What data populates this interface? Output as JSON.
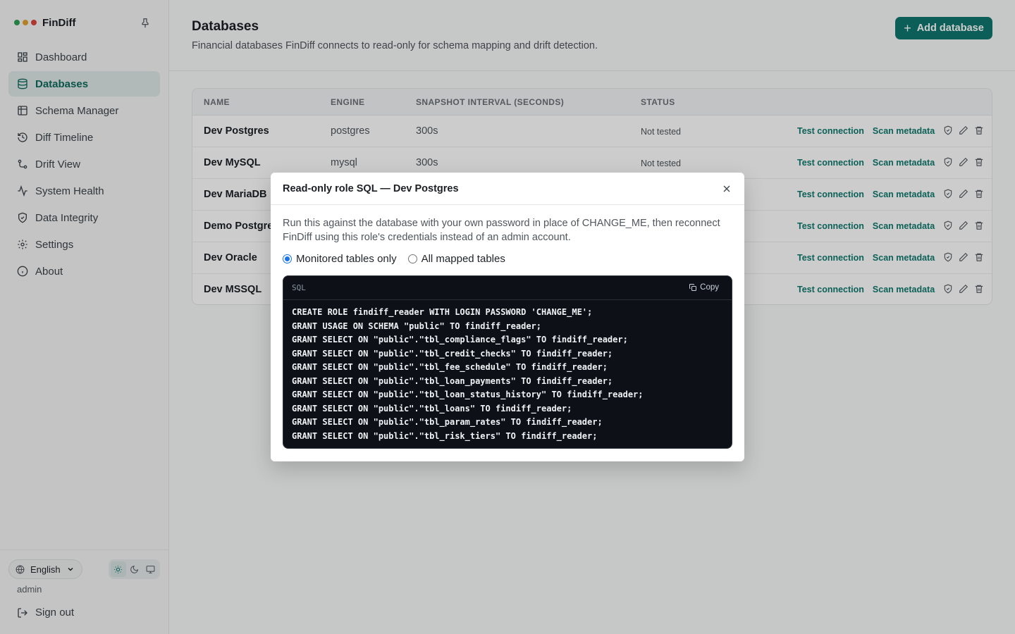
{
  "app": {
    "name": "FinDiff",
    "window_dots": [
      "#2e9e55",
      "#e0a033",
      "#d9453d"
    ]
  },
  "sidebar": {
    "items": [
      {
        "label": "Dashboard",
        "icon": "dashboard-icon"
      },
      {
        "label": "Databases",
        "icon": "database-icon",
        "active": true
      },
      {
        "label": "Schema Manager",
        "icon": "table-icon"
      },
      {
        "label": "Diff Timeline",
        "icon": "history-icon"
      },
      {
        "label": "Drift View",
        "icon": "git-branch-icon"
      },
      {
        "label": "System Health",
        "icon": "activity-icon"
      },
      {
        "label": "Data Integrity",
        "icon": "shield-icon"
      },
      {
        "label": "Settings",
        "icon": "gear-icon"
      },
      {
        "label": "About",
        "icon": "info-icon"
      }
    ],
    "language": "English",
    "user": "admin",
    "sign_out": "Sign out"
  },
  "header": {
    "title": "Databases",
    "subtitle": "Financial databases FinDiff connects to read-only for schema mapping and drift detection.",
    "add_button": "Add database"
  },
  "table": {
    "columns": [
      "NAME",
      "ENGINE",
      "SNAPSHOT INTERVAL (SECONDS)",
      "STATUS"
    ],
    "rows": [
      {
        "name": "Dev Postgres",
        "engine": "postgres",
        "interval": "300s",
        "status": "Not tested"
      },
      {
        "name": "Dev MySQL",
        "engine": "mysql",
        "interval": "300s",
        "status": "Not tested"
      },
      {
        "name": "Dev MariaDB",
        "engine": "",
        "interval": "",
        "status": ""
      },
      {
        "name": "Demo Postgre",
        "engine": "",
        "interval": "",
        "status": ""
      },
      {
        "name": "Dev Oracle",
        "engine": "",
        "interval": "",
        "status": ""
      },
      {
        "name": "Dev MSSQL",
        "engine": "",
        "interval": "",
        "status": ""
      }
    ],
    "action_test": "Test connection",
    "action_scan": "Scan metadata"
  },
  "modal": {
    "title": "Read-only role SQL — Dev Postgres",
    "description": "Run this against the database with your own password in place of CHANGE_ME, then reconnect FinDiff using this role's credentials instead of an admin account.",
    "radio_monitored": "Monitored tables only",
    "radio_all": "All mapped tables",
    "selected": "monitored",
    "code_lang": "SQL",
    "copy_label": "Copy",
    "sql": "CREATE ROLE findiff_reader WITH LOGIN PASSWORD 'CHANGE_ME';\nGRANT USAGE ON SCHEMA \"public\" TO findiff_reader;\nGRANT SELECT ON \"public\".\"tbl_compliance_flags\" TO findiff_reader;\nGRANT SELECT ON \"public\".\"tbl_credit_checks\" TO findiff_reader;\nGRANT SELECT ON \"public\".\"tbl_fee_schedule\" TO findiff_reader;\nGRANT SELECT ON \"public\".\"tbl_loan_payments\" TO findiff_reader;\nGRANT SELECT ON \"public\".\"tbl_loan_status_history\" TO findiff_reader;\nGRANT SELECT ON \"public\".\"tbl_loans\" TO findiff_reader;\nGRANT SELECT ON \"public\".\"tbl_param_rates\" TO findiff_reader;\nGRANT SELECT ON \"public\".\"tbl_risk_tiers\" TO findiff_reader;"
  },
  "colors": {
    "accent": "#0f766e",
    "accent_text": "#0f7a6f"
  }
}
